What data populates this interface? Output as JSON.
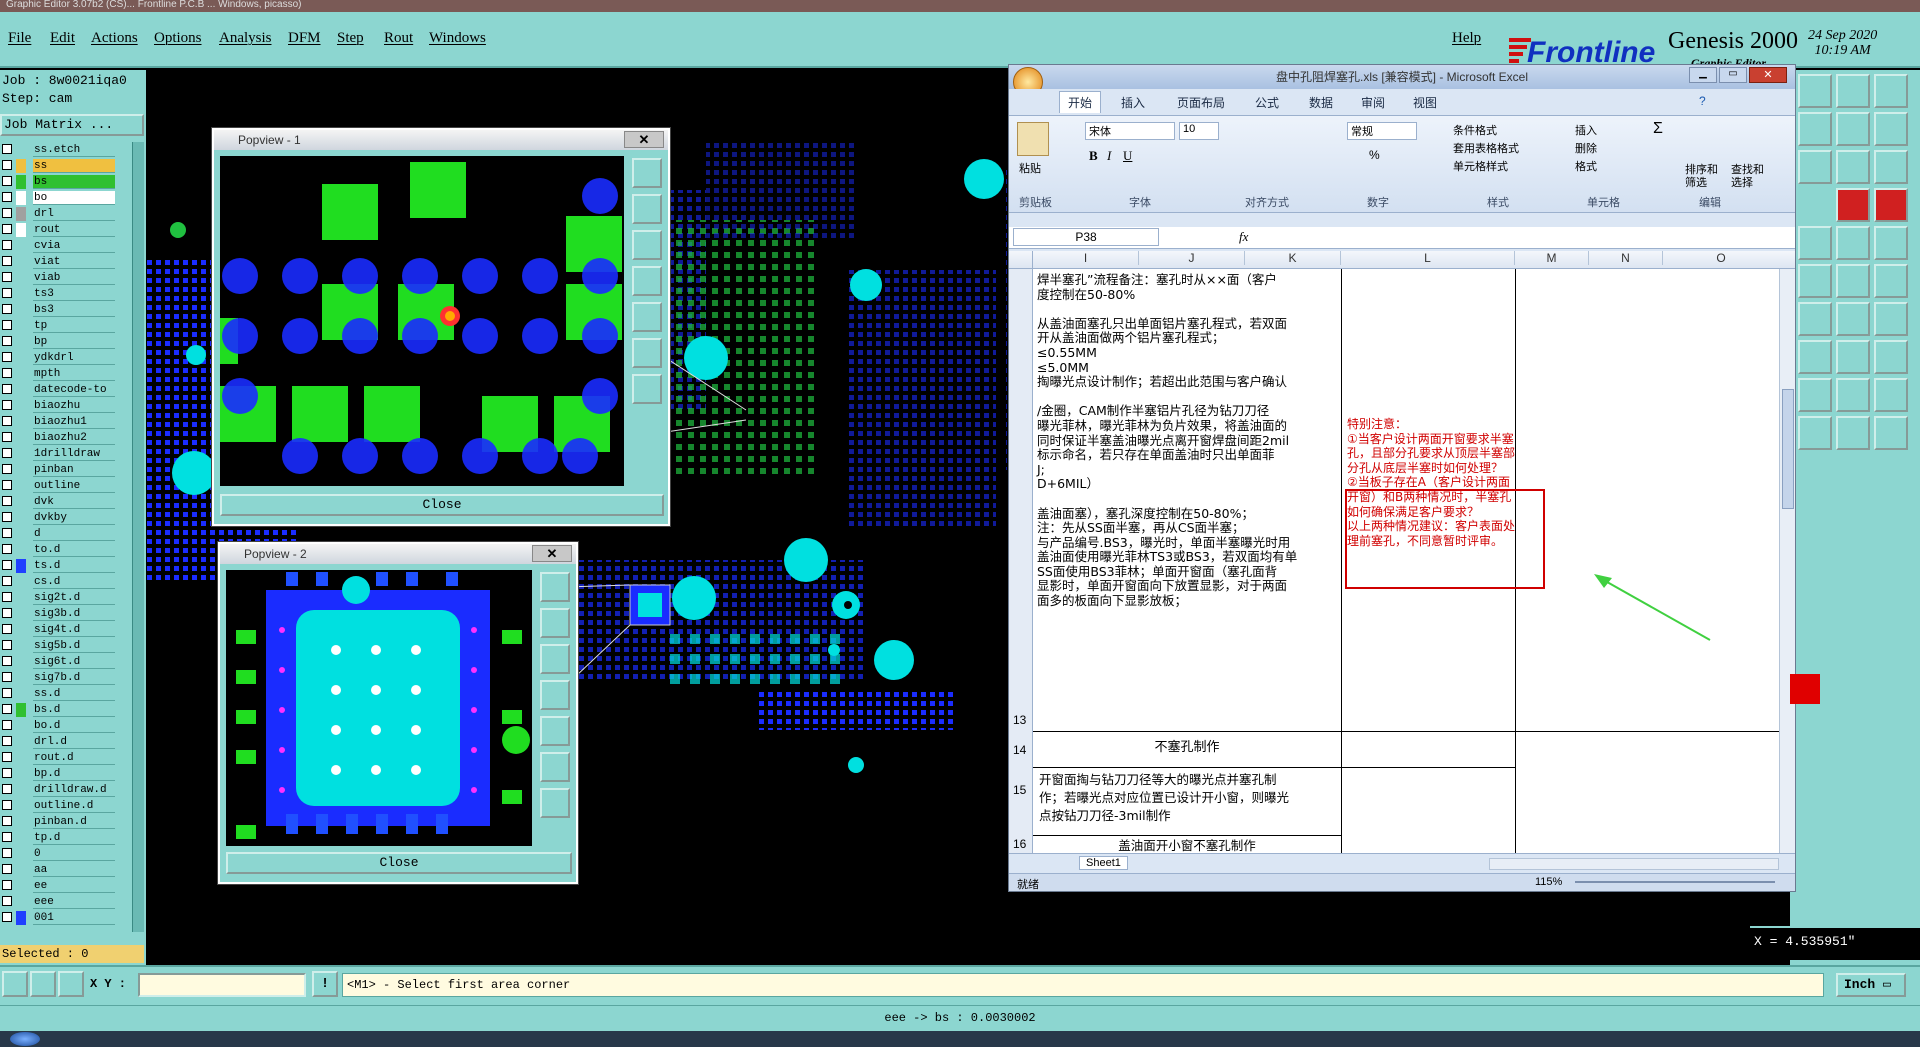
{
  "window_title": "Graphic Editor 3.07b2 (CS)... Frontline P.C.B ... Windows, picasso)",
  "menu": [
    "File",
    "Edit",
    "Actions",
    "Options",
    "Analysis",
    "DFM",
    "Step",
    "Rout",
    "Windows"
  ],
  "help": "Help",
  "brand": {
    "logo_text": "Frontline",
    "product": "Genesis 2000",
    "sub": "Graphic Editor",
    "date": "24 Sep 2020",
    "time": "10:19 AM"
  },
  "left": {
    "job": "Job : 8w0021iqa0",
    "step": "Step: cam",
    "matrix": "Job Matrix ...",
    "selected": "Selected : 0",
    "layers": [
      {
        "name": "ss.etch",
        "color": "#8cd6d0"
      },
      {
        "name": "ss",
        "color": "#f0c040"
      },
      {
        "name": "bs",
        "color": "#30c030"
      },
      {
        "name": "bo",
        "color": "#ffffff"
      },
      {
        "name": "drl",
        "color": "#a0a0a0"
      },
      {
        "name": "rout",
        "color": "#ffffff"
      },
      {
        "name": "cvia",
        "color": "#8cd6d0"
      },
      {
        "name": "viat",
        "color": "#8cd6d0"
      },
      {
        "name": "viab",
        "color": "#8cd6d0"
      },
      {
        "name": "ts3",
        "color": "#8cd6d0"
      },
      {
        "name": "bs3",
        "color": "#8cd6d0"
      },
      {
        "name": "tp",
        "color": "#8cd6d0"
      },
      {
        "name": "bp",
        "color": "#8cd6d0"
      },
      {
        "name": "ydkdrl",
        "color": "#8cd6d0"
      },
      {
        "name": "mpth",
        "color": "#8cd6d0"
      },
      {
        "name": "datecode-to",
        "color": "#8cd6d0"
      },
      {
        "name": "biaozhu",
        "color": "#8cd6d0"
      },
      {
        "name": "biaozhu1",
        "color": "#8cd6d0"
      },
      {
        "name": "biaozhu2",
        "color": "#8cd6d0"
      },
      {
        "name": "1drilldraw",
        "color": "#8cd6d0"
      },
      {
        "name": "pinban",
        "color": "#8cd6d0"
      },
      {
        "name": "outline",
        "color": "#8cd6d0"
      },
      {
        "name": "dvk",
        "color": "#8cd6d0"
      },
      {
        "name": "dvkby",
        "color": "#8cd6d0"
      },
      {
        "name": "d",
        "color": "#8cd6d0"
      },
      {
        "name": "to.d",
        "color": "#8cd6d0"
      },
      {
        "name": "ts.d",
        "color": "#2040ff"
      },
      {
        "name": "cs.d",
        "color": "#8cd6d0"
      },
      {
        "name": "sig2t.d",
        "color": "#8cd6d0"
      },
      {
        "name": "sig3b.d",
        "color": "#8cd6d0"
      },
      {
        "name": "sig4t.d",
        "color": "#8cd6d0"
      },
      {
        "name": "sig5b.d",
        "color": "#8cd6d0"
      },
      {
        "name": "sig6t.d",
        "color": "#8cd6d0"
      },
      {
        "name": "sig7b.d",
        "color": "#8cd6d0"
      },
      {
        "name": "ss.d",
        "color": "#8cd6d0"
      },
      {
        "name": "bs.d",
        "color": "#30c030"
      },
      {
        "name": "bo.d",
        "color": "#8cd6d0"
      },
      {
        "name": "drl.d",
        "color": "#8cd6d0"
      },
      {
        "name": "rout.d",
        "color": "#8cd6d0"
      },
      {
        "name": "bp.d",
        "color": "#8cd6d0"
      },
      {
        "name": "drilldraw.d",
        "color": "#8cd6d0"
      },
      {
        "name": "outline.d",
        "color": "#8cd6d0"
      },
      {
        "name": "pinban.d",
        "color": "#8cd6d0"
      },
      {
        "name": "tp.d",
        "color": "#8cd6d0"
      },
      {
        "name": "0",
        "color": "#8cd6d0"
      },
      {
        "name": "aa",
        "color": "#8cd6d0"
      },
      {
        "name": "ee",
        "color": "#8cd6d0"
      },
      {
        "name": "eee",
        "color": "#8cd6d0"
      },
      {
        "name": "001",
        "color": "#2040ff"
      }
    ]
  },
  "popview1": {
    "title": "Popview - 1",
    "close": "Close"
  },
  "popview2": {
    "title": "Popview - 2",
    "close": "Close"
  },
  "bottom": {
    "xy_label": "X Y :",
    "xy_value": "",
    "prompt": "<M1> - Select first area corner",
    "units": "Inch"
  },
  "status": "eee -> bs : 0.0030002",
  "x_readout": "X = 4.535951\"",
  "excel": {
    "title": "盘中孔阻焊塞孔.xls [兼容模式] - Microsoft Excel",
    "tabs": [
      "开始",
      "插入",
      "页面布局",
      "公式",
      "数据",
      "审阅",
      "视图"
    ],
    "font_name": "宋体",
    "font_size": "10",
    "number_format": "常规",
    "groups": [
      "剪贴板",
      "字体",
      "对齐方式",
      "数字",
      "样式",
      "单元格",
      "编辑"
    ],
    "ribbon_buttons": {
      "paste": "粘贴",
      "cond_format": "条件格式",
      "table_format": "套用表格格式",
      "cell_style": "单元格样式",
      "insert": "插入",
      "delete": "删除",
      "format": "格式",
      "sort": "排序和筛选",
      "find": "查找和选择"
    },
    "cell_ref": "P38",
    "fx": "fx",
    "columns": [
      "I",
      "J",
      "K",
      "L",
      "M",
      "N",
      "O"
    ],
    "rows": [
      "13",
      "14",
      "15",
      "16"
    ],
    "col_ijk_text": [
      "焊半塞孔”流程备注：塞孔时从××面（客户",
      "度控制在50-80%",
      "",
      "从盖油面塞孔只出单面铝片塞孔程式，若双面",
      "开从盖油面做两个铝片塞孔程式；",
      "≤0.55MM",
      "≤5.0MM",
      "掏曝光点设计制作；若超出此范围与客户确认",
      "",
      "/金圈，CAM制作半塞铝片孔径为钻刀刀径",
      "曝光菲林，曝光菲林为负片效果，将盖油面的",
      "同时保证半塞盖油曝光点离开窗焊盘间距2mil",
      "标示命名，若只存在单面盖油时只出单面菲",
      "J;",
      "D+6MIL）",
      "",
      "盖油面塞），塞孔深度控制在50-80%；",
      "注：先从SS面半塞，再从CS面半塞；",
      "与产品编号.BS3，曝光时，单面半塞曝光时用",
      "盖油面使用曝光菲林TS3或BS3，若双面均有单",
      "SS面使用BS3菲林；单面开窗面（塞孔面背",
      "显影时，单面开窗面向下放置显影，对于两面",
      "面多的板面向下显影放板；"
    ],
    "col_l_text": [
      "特别注意：",
      "①当客户设计两面开窗要求半塞",
      "孔，且部分孔要求从顶层半塞部",
      "分孔从底层半塞时如何处理？",
      "②当板子存在A（客户设计两面",
      "开窗）和B两种情况时，半塞孔",
      "如何确保满足客户要求？",
      "以上两种情况建议：客户表面处",
      "理前塞孔，不同意暂时评审。"
    ],
    "row14": "不塞孔制作",
    "row15": [
      "开窗面掏与钻刀刀径等大的曝光点并塞孔制",
      "作；若曝光点对应位置已设计开小窗，则曝光",
      "点按钻刀刀径-3mil制作"
    ],
    "row16": "盖油面开小窗不塞孔制作",
    "sheet_tab": "Sheet1",
    "status_ready": "就绪",
    "zoom": "115%"
  }
}
